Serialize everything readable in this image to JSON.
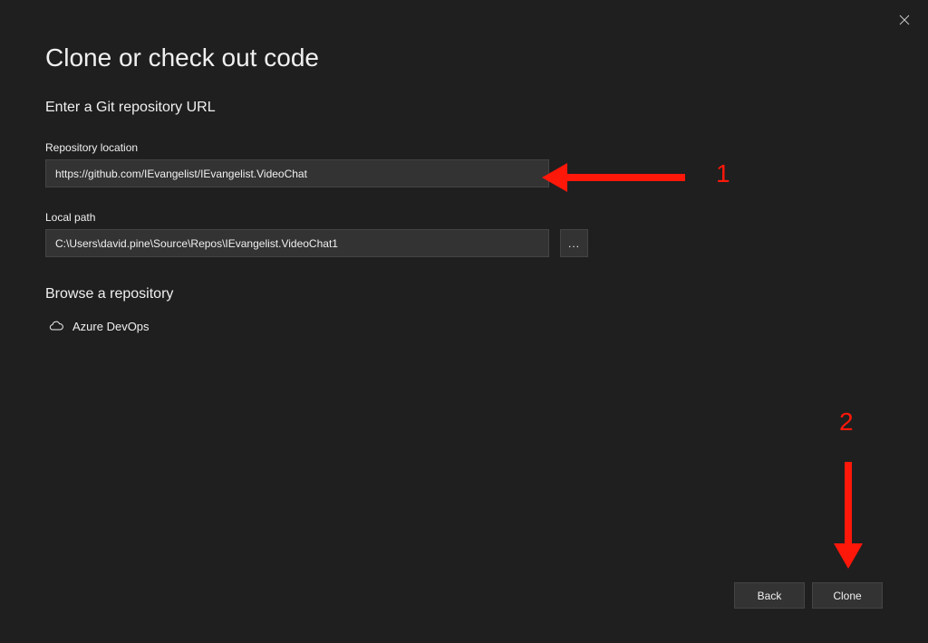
{
  "title": "Clone or check out code",
  "section1": {
    "heading": "Enter a Git repository URL",
    "repo_label": "Repository location",
    "repo_value": "https://github.com/IEvangelist/IEvangelist.VideoChat",
    "path_label": "Local path",
    "path_value": "C:\\Users\\david.pine\\Source\\Repos\\IEvangelist.VideoChat1",
    "browse_label": "..."
  },
  "section2": {
    "heading": "Browse a repository",
    "azure_label": "Azure DevOps"
  },
  "footer": {
    "back_label": "Back",
    "clone_label": "Clone"
  },
  "annotations": {
    "num1": "1",
    "num2": "2",
    "arrow_color": "#fe180a"
  }
}
